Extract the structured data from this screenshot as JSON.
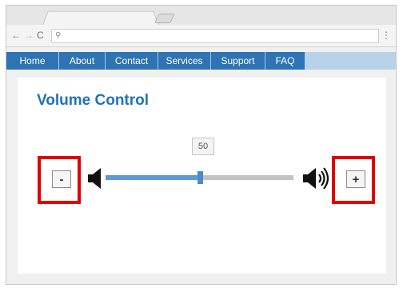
{
  "browser": {
    "nav_back": "←",
    "nav_forward": "→",
    "reload": "C",
    "search_glyph": "⚲",
    "address_value": "",
    "menu": "⋮"
  },
  "nav": {
    "items": [
      {
        "label": "Home"
      },
      {
        "label": "About"
      },
      {
        "label": "Contact"
      },
      {
        "label": "Services"
      },
      {
        "label": "Support"
      },
      {
        "label": "FAQ"
      }
    ]
  },
  "page": {
    "title": "Volume Control"
  },
  "volume": {
    "value": 50,
    "value_label": "50",
    "min": 0,
    "max": 100,
    "decrease_label": "-",
    "increase_label": "+",
    "low_icon": "speaker-low-icon",
    "high_icon": "speaker-high-icon"
  },
  "colors": {
    "nav_bg": "#2e74b5",
    "nav_strip": "#b8d2ea",
    "title": "#1f73b7",
    "slider_fill": "#5b9bd5",
    "slider_track": "#c2c2c2",
    "highlight": "#e00000"
  }
}
